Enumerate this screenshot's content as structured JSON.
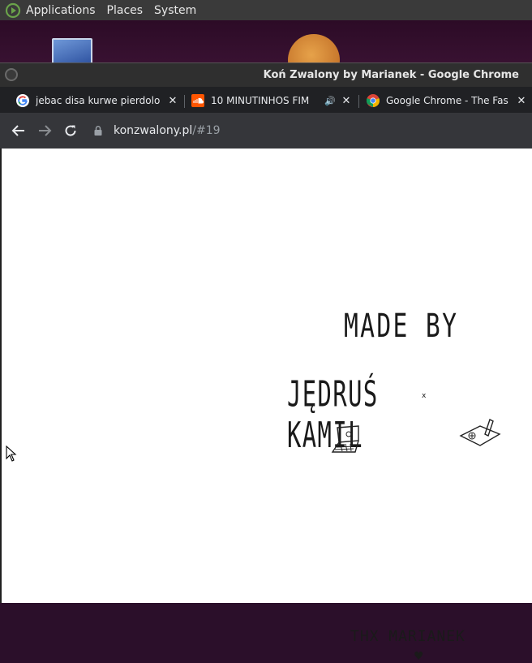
{
  "panel": {
    "menus": [
      "Applications",
      "Places",
      "System"
    ]
  },
  "window": {
    "title": "Koń Zwalony by Marianek - Google Chrome"
  },
  "tabs": [
    {
      "label": "jebac disa kurwe pierdolo",
      "favicon": "google-g-icon"
    },
    {
      "label": "10 MINUTINHOS FIM",
      "favicon": "soundcloud-icon",
      "audio": "🔊"
    },
    {
      "label": "Google Chrome - The Fas",
      "favicon": "chrome-icon"
    }
  ],
  "toolbar": {
    "url_host": "konzwalony.pl",
    "url_path": "/#19"
  },
  "page": {
    "made_by": "MADE BY",
    "names": "JĘDRUŚ  KAMIL",
    "separator": "x",
    "thanks": "THX MARIANEK",
    "heart": "♥"
  },
  "colors": {
    "panel": "#3a3a3a",
    "tabstrip": "#202124",
    "toolbar": "#35363a",
    "desktop": "#2c0b26"
  }
}
